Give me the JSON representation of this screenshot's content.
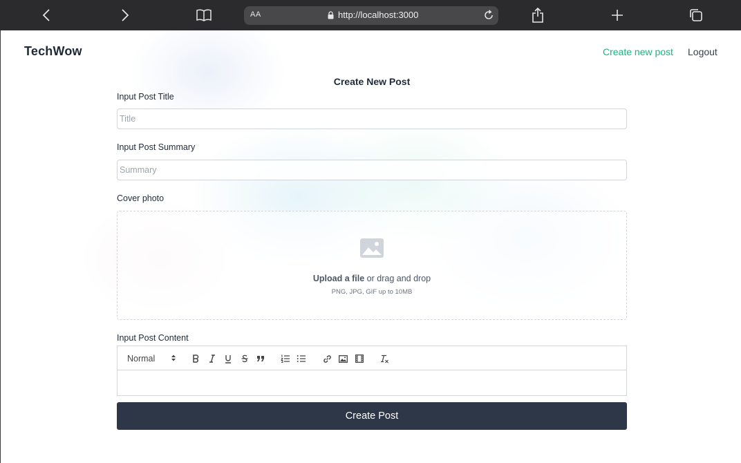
{
  "browser": {
    "reader_label": "AA",
    "url": "http://localhost:3000"
  },
  "header": {
    "brand": "TechWow",
    "nav_create": "Create new post",
    "nav_logout": "Logout"
  },
  "form": {
    "title": "Create New Post",
    "title_label": "Input Post Title",
    "title_placeholder": "Title",
    "title_value": "",
    "summary_label": "Input Post Summary",
    "summary_placeholder": "Summary",
    "summary_value": "",
    "cover_label": "Cover photo",
    "upload_link": "Upload a file",
    "upload_rest": " or drag and drop",
    "upload_hint": "PNG, JPG, GIF up to 10MB",
    "content_label": "Input Post Content",
    "heading_select": "Normal",
    "submit_label": "Create Post"
  },
  "colors": {
    "accent": "#10b981",
    "button": "#2d3748",
    "chrome": "#2b2b2d"
  }
}
